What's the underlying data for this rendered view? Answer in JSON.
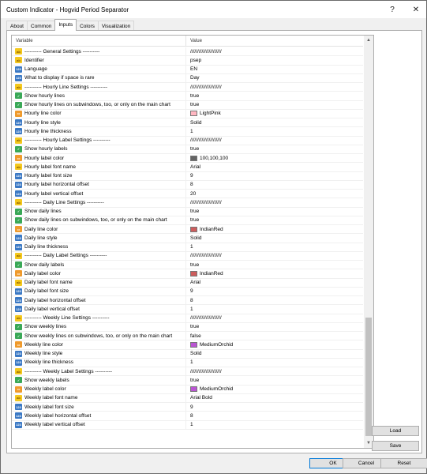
{
  "window": {
    "title": "Custom Indicator - Hogvid Period Separator",
    "help_glyph": "?",
    "close_glyph": "✕"
  },
  "tabs": [
    "About",
    "Common",
    "Inputs",
    "Colors",
    "Visualization"
  ],
  "columns": {
    "variable": "Variable",
    "value": "Value"
  },
  "rows": [
    {
      "type": "str",
      "icon": "ab",
      "name": "---------- General Settings ----------",
      "value": "//////////////////////"
    },
    {
      "type": "str",
      "icon": "ab",
      "name": "Identifier",
      "value": "psep"
    },
    {
      "type": "enum",
      "icon": "123",
      "name": "Language",
      "value": "EN"
    },
    {
      "type": "enum",
      "icon": "123",
      "name": "What to display if space is rare",
      "value": "Day"
    },
    {
      "type": "str",
      "icon": "ab",
      "name": "---------- Hourly Line Settings ----------",
      "value": "//////////////////////"
    },
    {
      "type": "bool",
      "icon": "✓",
      "name": "Show hourly lines",
      "value": "true"
    },
    {
      "type": "bool",
      "icon": "✓",
      "name": "Show hourly lines on subwindows, too, or only on the main chart",
      "value": "true"
    },
    {
      "type": "color",
      "icon": "▭",
      "name": "Hourly line color",
      "value": "LightPink",
      "swatch": "#ffb6c1"
    },
    {
      "type": "enum",
      "icon": "123",
      "name": "Hourly line style",
      "value": "Solid"
    },
    {
      "type": "int",
      "icon": "123",
      "name": "Hourly line thickness",
      "value": "1"
    },
    {
      "type": "str",
      "icon": "ab",
      "name": "---------- Hourly Label Settings ----------",
      "value": "//////////////////////"
    },
    {
      "type": "bool",
      "icon": "✓",
      "name": "Show hourly labels",
      "value": "true"
    },
    {
      "type": "color",
      "icon": "▭",
      "name": "Hourly label color",
      "value": "100,100,100",
      "swatch": "#646464"
    },
    {
      "type": "str",
      "icon": "ab",
      "name": "Hourly label font name",
      "value": "Arial"
    },
    {
      "type": "int",
      "icon": "123",
      "name": "Hourly label font size",
      "value": "9"
    },
    {
      "type": "int",
      "icon": "123",
      "name": "Hourly label horizontal offset",
      "value": "8"
    },
    {
      "type": "int",
      "icon": "123",
      "name": "Hourly label vertical offset",
      "value": "20"
    },
    {
      "type": "str",
      "icon": "ab",
      "name": "---------- Daily Line Settings ----------",
      "value": "//////////////////////"
    },
    {
      "type": "bool",
      "icon": "✓",
      "name": "Show daily lines",
      "value": "true"
    },
    {
      "type": "bool",
      "icon": "✓",
      "name": "Show daily lines on subwindows, too, or only on the main chart",
      "value": "true"
    },
    {
      "type": "color",
      "icon": "▭",
      "name": "Daily line color",
      "value": "IndianRed",
      "swatch": "#cd5c5c"
    },
    {
      "type": "enum",
      "icon": "123",
      "name": "Daily line style",
      "value": "Solid"
    },
    {
      "type": "int",
      "icon": "123",
      "name": "Daily line thickness",
      "value": "1"
    },
    {
      "type": "str",
      "icon": "ab",
      "name": "---------- Daily Label Settings ----------",
      "value": "//////////////////////"
    },
    {
      "type": "bool",
      "icon": "✓",
      "name": "Show daily labels",
      "value": "true"
    },
    {
      "type": "color",
      "icon": "▭",
      "name": "Daily label color",
      "value": "IndianRed",
      "swatch": "#cd5c5c"
    },
    {
      "type": "str",
      "icon": "ab",
      "name": "Daily label font name",
      "value": "Arial"
    },
    {
      "type": "int",
      "icon": "123",
      "name": "Daily label font size",
      "value": "9"
    },
    {
      "type": "int",
      "icon": "123",
      "name": "Daily label horizontal offset",
      "value": "8"
    },
    {
      "type": "int",
      "icon": "123",
      "name": "Daily label vertical offset",
      "value": "1"
    },
    {
      "type": "str",
      "icon": "ab",
      "name": "---------- Weekly Line Settings ----------",
      "value": "//////////////////////"
    },
    {
      "type": "bool",
      "icon": "✓",
      "name": "Show weekly lines",
      "value": "true"
    },
    {
      "type": "bool",
      "icon": "✓",
      "name": "Show weekly lines on subwindows, too, or only on the main chart",
      "value": "false"
    },
    {
      "type": "color",
      "icon": "▭",
      "name": "Weekly line color",
      "value": "MediumOrchid",
      "swatch": "#ba55d3"
    },
    {
      "type": "enum",
      "icon": "123",
      "name": "Weekly line style",
      "value": "Solid"
    },
    {
      "type": "int",
      "icon": "123",
      "name": "Weekly line thickness",
      "value": "1"
    },
    {
      "type": "str",
      "icon": "ab",
      "name": "---------- Weekly Label Settings ----------",
      "value": "//////////////////////"
    },
    {
      "type": "bool",
      "icon": "✓",
      "name": "Show weekly labels",
      "value": "true"
    },
    {
      "type": "color",
      "icon": "▭",
      "name": "Weekly label color",
      "value": "MediumOrchid",
      "swatch": "#ba55d3"
    },
    {
      "type": "str",
      "icon": "ab",
      "name": "Weekly label font name",
      "value": "Arial Bold"
    },
    {
      "type": "int",
      "icon": "123",
      "name": "Weekly label font size",
      "value": "9"
    },
    {
      "type": "int",
      "icon": "123",
      "name": "Weekly label horizontal offset",
      "value": "8"
    },
    {
      "type": "int",
      "icon": "123",
      "name": "Weekly label vertical offset",
      "value": "1"
    }
  ],
  "side_buttons": {
    "load": "Load",
    "save": "Save"
  },
  "footer_buttons": {
    "ok": "OK",
    "cancel": "Cancel",
    "reset": "Reset"
  }
}
